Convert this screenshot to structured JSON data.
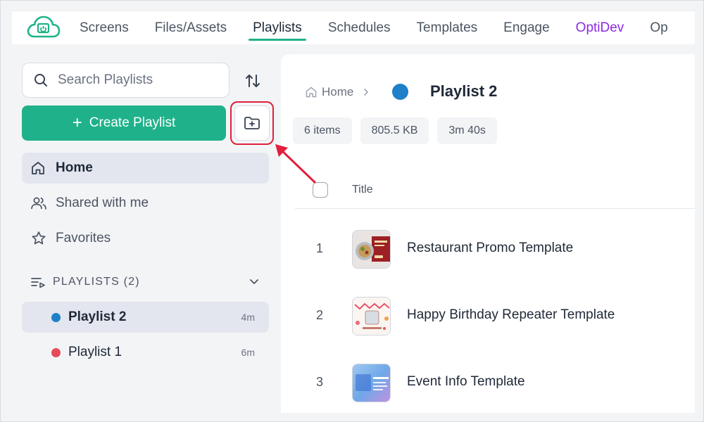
{
  "nav": {
    "items": [
      {
        "label": "Screens",
        "active": false
      },
      {
        "label": "Files/Assets",
        "active": false
      },
      {
        "label": "Playlists",
        "active": true
      },
      {
        "label": "Schedules",
        "active": false
      },
      {
        "label": "Templates",
        "active": false
      },
      {
        "label": "Engage",
        "active": false
      },
      {
        "label": "OptiDev",
        "active": false
      },
      {
        "label": "Op",
        "active": false
      }
    ]
  },
  "sidebar": {
    "search_placeholder": "Search Playlists",
    "create_label": "Create Playlist",
    "items": [
      {
        "label": "Home"
      },
      {
        "label": "Shared with me"
      },
      {
        "label": "Favorites"
      }
    ],
    "section_label": "PLAYLISTS (2)",
    "playlists": [
      {
        "label": "Playlist 2",
        "duration": "4m",
        "color": "#1e80c8"
      },
      {
        "label": "Playlist 1",
        "duration": "6m",
        "color": "#e54b59"
      }
    ]
  },
  "main": {
    "breadcrumb_home": "Home",
    "playlist_title": "Playlist 2",
    "playlist_color": "#1e80c8",
    "chips": [
      "6 items",
      "805.5 KB",
      "3m 40s"
    ],
    "column_title": "Title",
    "rows": [
      {
        "num": "1",
        "title": "Restaurant Promo Template"
      },
      {
        "num": "2",
        "title": "Happy Birthday Repeater Template"
      },
      {
        "num": "3",
        "title": "Event Info Template"
      }
    ]
  },
  "colors": {
    "accent": "#1fb28a",
    "highlight": "#e0203c",
    "optidev": "#8a2be2"
  }
}
